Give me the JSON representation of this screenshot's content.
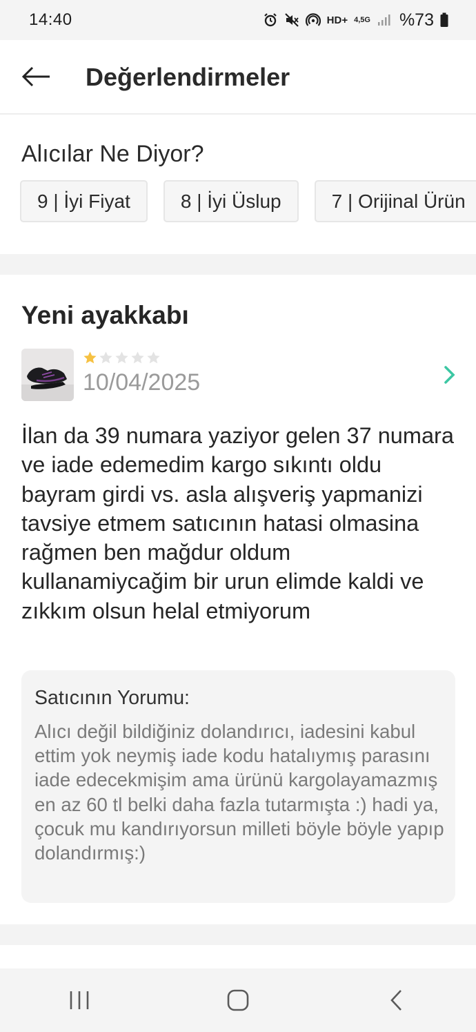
{
  "status_bar": {
    "time": "14:40",
    "hd_label": "HD+",
    "network_label": "4,5G",
    "battery_text": "%73",
    "icons": [
      "alarm-icon",
      "mute-icon",
      "hotspot-icon",
      "hd-voice-icon",
      "mobile-data-icon",
      "signal-icon",
      "battery-icon"
    ]
  },
  "header": {
    "title": "Değerlendirmeler",
    "back_icon": "arrow-left-icon"
  },
  "buyers_say": {
    "title": "Alıcılar Ne Diyor?",
    "tags": [
      {
        "label": "9 | İyi Fiyat"
      },
      {
        "label": "8 | İyi Üslup"
      },
      {
        "label": "7 | Orijinal Ürün"
      }
    ]
  },
  "review": {
    "title": "Yeni ayakkabı",
    "rating": 1,
    "rating_max": 5,
    "date": "10/04/2025",
    "text": "İlan da 39 numara yaziyor gelen 37 numara ve iade edemedim kargo sıkıntı oldu bayram girdi vs. asla alışveriş yapmanizi tavsiye etmem satıcının hatasi olmasina rağmen ben mağdur oldum kullanamiycağim bir urun elimde kaldi ve zıkkım olsun helal etmiyorum",
    "seller_label": "Satıcının Yorumu:",
    "seller_text": "Alıcı değil bildiğiniz dolandırıcı, iadesini kabul ettim yok neymiş iade kodu hatalıymış parasını iade edecekmişim ama ürünü kargolayamazmış en az 60 tl belki daha fazla tutarmışta :) hadi ya, çocuk mu kandırıyorsun milleti böyle böyle yapıp dolandırmış:)"
  },
  "colors": {
    "accent_chevron": "#3cc7a3",
    "star_filled": "#f6c142",
    "star_empty": "#e3e3e3"
  },
  "nav_bar": {
    "icons": [
      "recent-apps-icon",
      "home-icon",
      "back-icon"
    ]
  }
}
